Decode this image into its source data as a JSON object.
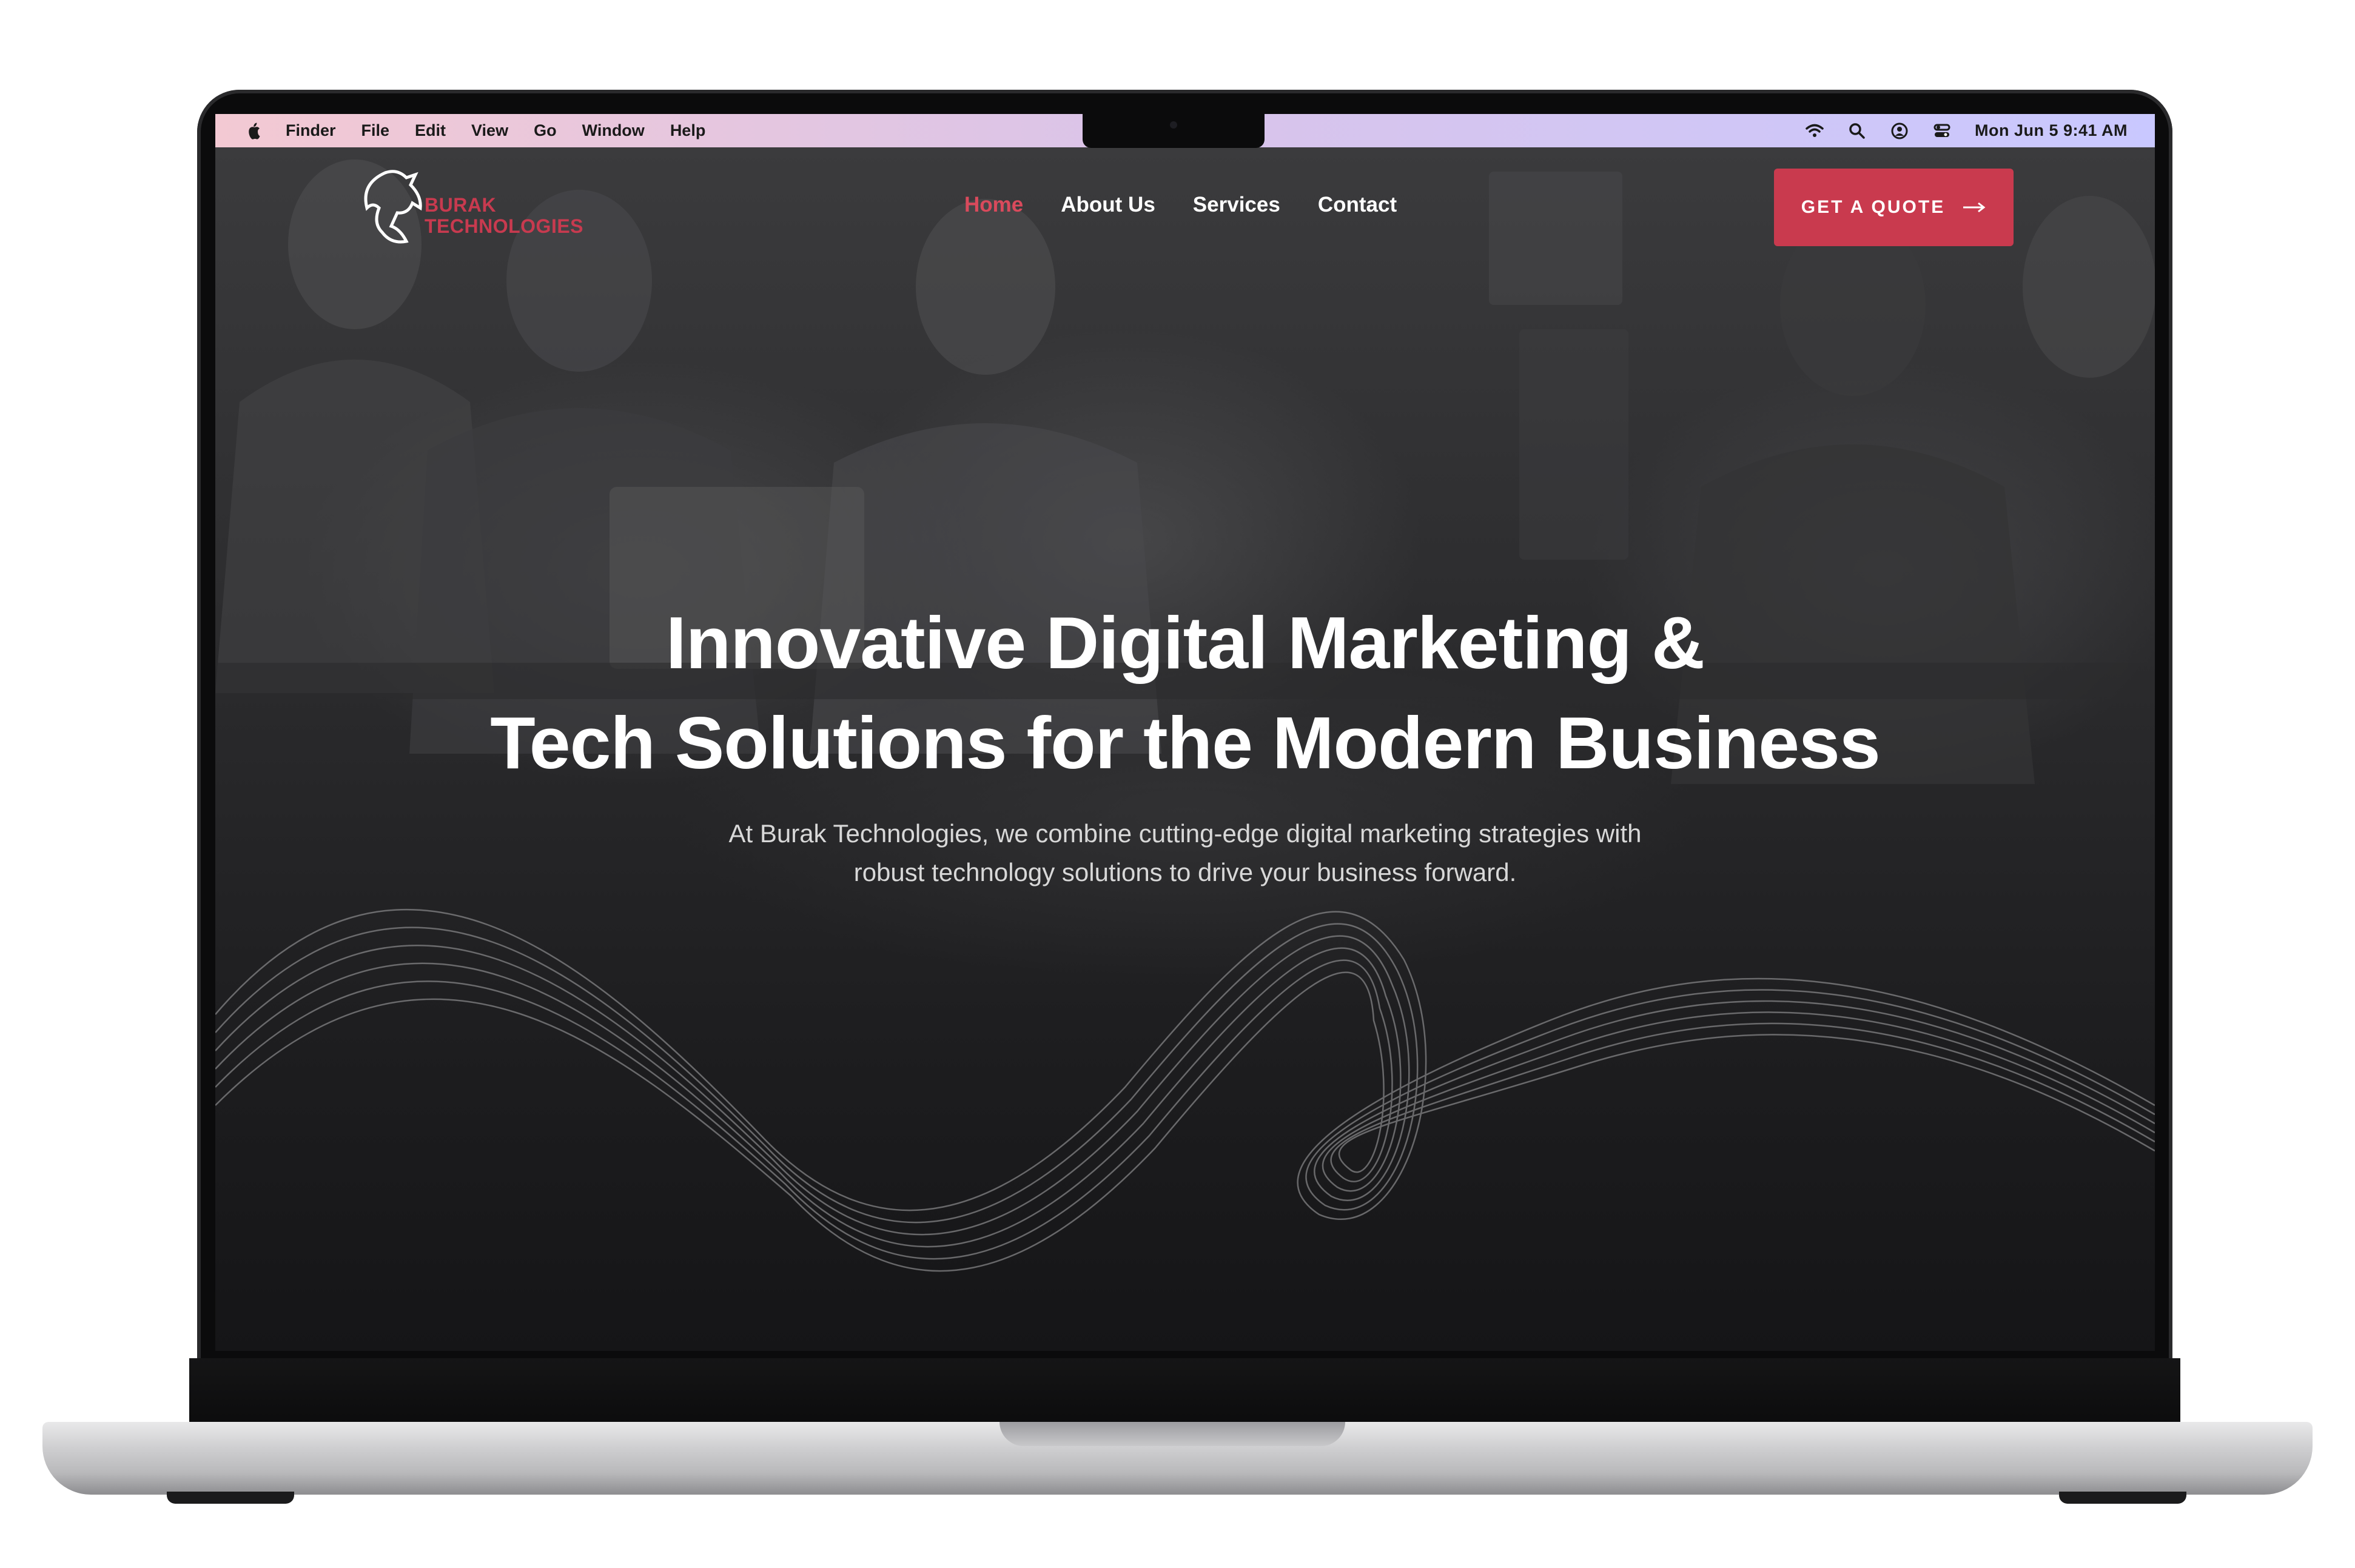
{
  "menubar": {
    "apple_icon": "apple-icon",
    "items": [
      "Finder",
      "File",
      "Edit",
      "View",
      "Go",
      "Window",
      "Help"
    ],
    "tray_icons": [
      "wifi-icon",
      "search-icon",
      "user-icon",
      "control-center-icon"
    ],
    "clock": "Mon Jun 5  9:41 AM"
  },
  "site": {
    "logo": {
      "line1": "BURAK",
      "line2": "TECHNOLOGIES",
      "icon": "horse-head-icon"
    },
    "nav": {
      "home": "Home",
      "about": "About Us",
      "services": "Services",
      "contact": "Contact"
    },
    "cta_label": "GET A QUOTE",
    "cta_icon": "arrow-right-icon",
    "headline_line1": "Innovative Digital Marketing &",
    "headline_line2": "Tech Solutions for the Modern Business",
    "subtext_line1": "At Burak Technologies, we combine cutting-edge digital marketing strategies with",
    "subtext_line2": "robust technology solutions to drive your business forward."
  },
  "colors": {
    "accent": "#c93a4e",
    "active_nav": "#d94a5c",
    "menubar_left": "#f3c9d3",
    "menubar_right": "#c9c8ff",
    "hero_dark": "#1c1c1e"
  }
}
